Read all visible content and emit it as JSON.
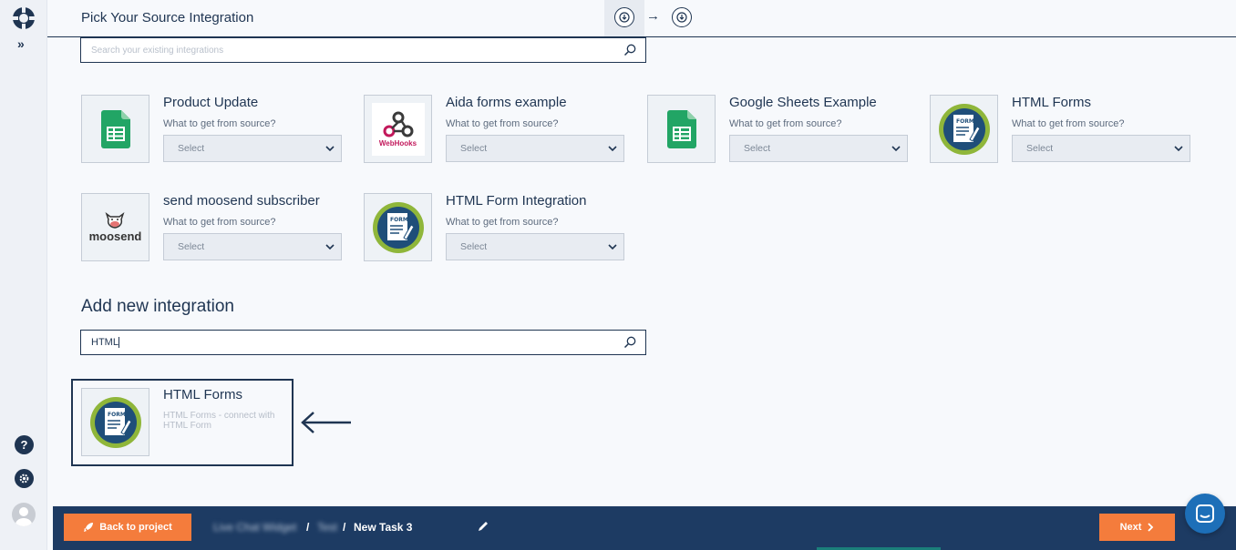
{
  "header": {
    "title": "Pick Your Source Integration"
  },
  "existing": {
    "search_placeholder": "Search your existing integrations",
    "question": "What to get from source?",
    "select_label": "Select",
    "cards": [
      {
        "name": "Product Update",
        "icon": "google-sheets-icon"
      },
      {
        "name": "Aida forms example",
        "icon": "webhooks-icon",
        "icon_text": "WebHooks"
      },
      {
        "name": "Google Sheets Example",
        "icon": "google-sheets-icon"
      },
      {
        "name": "HTML Forms",
        "icon": "html-form-icon"
      },
      {
        "name": "send moosend subscriber",
        "icon": "moosend-icon",
        "icon_text": "moosend"
      },
      {
        "name": "HTML Form Integration",
        "icon": "html-form-icon"
      }
    ]
  },
  "add_new": {
    "title": "Add new integration",
    "search_value": "HTML",
    "result": {
      "name": "HTML Forms",
      "description": "HTML Forms - connect with HTML Form",
      "icon": "html-form-icon"
    }
  },
  "footer": {
    "back_label": "Back to project",
    "crumb_1": "Live Chat Widget",
    "crumb_2": "Test",
    "task": "New Task 3",
    "next_label": "Next"
  },
  "colors": {
    "navy": "#1d3b63",
    "accent": "#f47c3c",
    "chat": "#1d6fb8"
  }
}
